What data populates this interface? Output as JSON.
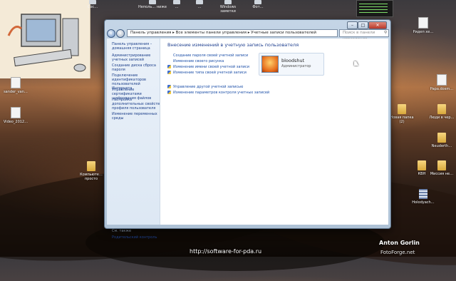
{
  "top_icons": [
    {
      "label": "Сос…"
    },
    {
      "label": "Неполь… ниже"
    },
    {
      "label": "…"
    },
    {
      "label": "…"
    },
    {
      "label": "Windows заметки"
    },
    {
      "label": "Фот…"
    }
  ],
  "desktop_icons_left": [
    {
      "label": "sander_van…",
      "icon": "document-icon"
    },
    {
      "label": "Video_2012…",
      "icon": "video-file-icon"
    },
    {
      "label": "Компьюте… просто",
      "icon": "folder-icon"
    }
  ],
  "desktop_icons_right": [
    {
      "label": "Ридеп хе…",
      "icon": "document-icon"
    },
    {
      "label": "Papa.dosm…",
      "icon": "document-icon"
    },
    {
      "label": "Новая папка (2)",
      "icon": "folder-icon"
    },
    {
      "label": "Люди в чер…",
      "icon": "folder-icon"
    },
    {
      "label": "Neuderth…",
      "icon": "folder-icon"
    },
    {
      "label": "КВН",
      "icon": "folder-icon"
    },
    {
      "label": "Миссия не…",
      "icon": "folder-icon"
    },
    {
      "label": "Holodyach…",
      "icon": "archive-icon"
    }
  ],
  "window": {
    "controls": {
      "minimize": "–",
      "maximize": "□",
      "close": "✕"
    },
    "address": "Панель управления ▸ Все элементы панели управления ▸ Учетные записи пользователей",
    "search_placeholder": "Поиск в панели управления",
    "sidebar": {
      "home": "Панель управления – домашняя страница",
      "items": [
        "Администрирование учетных записей",
        "Создание диска сброса пароля",
        "Подключение идентификаторов пользователей Интернета",
        "Управление сертификатами шифрования файлов",
        "Настройка дополнительных свойств профиля пользователя",
        "Изменение переменных среды"
      ],
      "see_also": "См. также",
      "parental": "Родительский контроль"
    },
    "main": {
      "heading": "Внесение изменений в учетную запись пользователя",
      "links": [
        {
          "text": "Создание пароля своей учетной записи",
          "shield": false
        },
        {
          "text": "Изменение своего рисунка",
          "shield": false
        },
        {
          "text": "Изменение имени своей учетной записи",
          "shield": true
        },
        {
          "text": "Изменение типа своей учетной записи",
          "shield": true
        }
      ],
      "links2": [
        {
          "text": "Управление другой учетной записью",
          "shield": true
        },
        {
          "text": "Изменение параметров контроля учетных записей",
          "shield": true
        }
      ],
      "user": {
        "name": "bloodshut",
        "role": "Администратор"
      }
    }
  },
  "watermark": {
    "url": "http://software-for-pda.ru",
    "author": "Anton Gorlin",
    "brand": "FotoForge.net"
  }
}
